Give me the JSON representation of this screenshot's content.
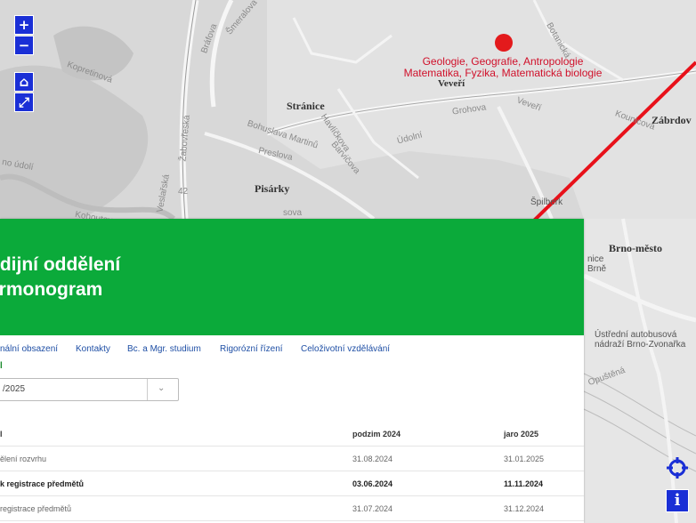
{
  "map": {
    "controls": {
      "zoom_in": "+",
      "zoom_out": "−",
      "home": "⌂",
      "fullscreen": "⤢",
      "info": "i"
    },
    "faculty_label": [
      "Geologie, Geografie, Antropologie",
      "Matematika, Fyzika, Matematická biologie"
    ],
    "places": {
      "stranice": "Stránice",
      "pisarky": "Pisárky",
      "zabrdovice": "Zábrdov",
      "brno_mesto": "Brno-město",
      "veveri": "Veveří",
      "nadrazi": [
        "Ústřední autobusová",
        "nádraží Brno-Zvonařka"
      ],
      "brno_center": [
        "nice",
        "Brně"
      ]
    },
    "streets": {
      "koprivova": "Kopretinová",
      "bratrova": "Bráfova",
      "simkova": "Šmeralova",
      "zabovreska": "Žabovřeská",
      "veslarska": "Veslařská",
      "bohuslava": "Bohuslava Martinů",
      "preslova": "Preslova",
      "havlickova": "Havlíčkova",
      "barvicova": "Barvičova",
      "udolni": "Údolní",
      "udolni2": "no údolí",
      "gronova": "Grohova",
      "veveri_st": "Veveří",
      "kounicova": "Kounicova",
      "spilberk": "Špilberk",
      "kohoutova": "Kohoutova",
      "bot": "Botanická",
      "opustena": "Opuštěná",
      "road42": "42",
      "sova": "sova"
    },
    "colors": {
      "arrow": "#e8111a",
      "dot": "#e31a1c",
      "control": "#1a2fd6"
    }
  },
  "panel": {
    "title_line1": "udijní oddělení",
    "title_line2": "armonogram",
    "nav": [
      "nální obsazení",
      "Kontakty",
      "Bc. a Mgr. studium",
      "Rigorózní řízení",
      "Celoživotní vzdělávání"
    ],
    "select_label": "l",
    "select_value": "/2025",
    "table": {
      "headers": [
        "l",
        "podzim 2024",
        "jaro 2025"
      ],
      "rows": [
        {
          "label": "ělení rozvrhu",
          "autumn": "31.08.2024",
          "spring": "31.01.2025",
          "bold": false
        },
        {
          "label": "k registrace předmětů",
          "autumn": "03.06.2024",
          "spring": "11.11.2024",
          "bold": true
        },
        {
          "label": "registrace předmětů",
          "autumn": "31.07.2024",
          "spring": "31.12.2024",
          "bold": false
        }
      ]
    },
    "colors": {
      "banner": "#0baa3a",
      "nav_link": "#1f4fa5"
    }
  }
}
